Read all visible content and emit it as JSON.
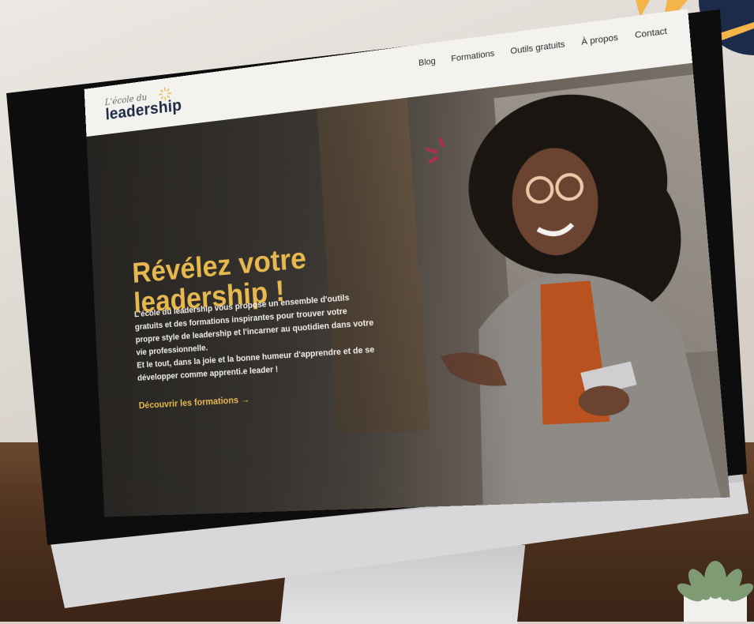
{
  "brand": {
    "logo_small": "L'école du",
    "logo_big": "leadership"
  },
  "nav": {
    "items": [
      "Blog",
      "Formations",
      "Outils gratuits",
      "À propos",
      "Contact"
    ]
  },
  "hero": {
    "title": "Révélez votre leadership !",
    "paragraph_1": "L'école du leadership vous propose un ensemble d'outils gratuits et des formations inspirantes pour trouver votre propre style de leadership et l'incarner au quotidien dans votre vie professionnelle.",
    "paragraph_2": "Et le tout, dans la joie et la bonne humeur d'apprendre et de se développer comme apprenti.e leader !",
    "cta_label": "Découvrir les formations",
    "cta_arrow": "→"
  },
  "colors": {
    "accent_gold": "#e6b84f",
    "brand_navy": "#1f2a44",
    "accent_red": "#b0304a",
    "navbar_bg": "#f3f2ef"
  },
  "icons": {
    "logo": "sun-icon",
    "cta": "arrow-right-icon"
  }
}
